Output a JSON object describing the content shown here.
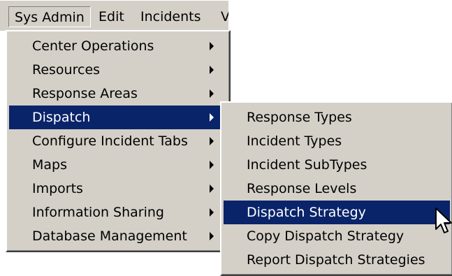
{
  "menubar": {
    "items": [
      {
        "label": "Sys Admin"
      },
      {
        "label": "Edit"
      },
      {
        "label": "Incidents"
      },
      {
        "label": "V"
      }
    ]
  },
  "sys_admin_menu": {
    "items": [
      {
        "label": "Center Operations",
        "has_submenu": true
      },
      {
        "label": "Resources",
        "has_submenu": true
      },
      {
        "label": "Response Areas",
        "has_submenu": true
      },
      {
        "label": "Dispatch",
        "has_submenu": true,
        "selected": true
      },
      {
        "label": "Configure Incident Tabs",
        "has_submenu": true
      },
      {
        "label": "Maps",
        "has_submenu": true
      },
      {
        "label": "Imports",
        "has_submenu": true
      },
      {
        "label": "Information Sharing",
        "has_submenu": true
      },
      {
        "label": "Database Management",
        "has_submenu": true
      }
    ]
  },
  "dispatch_submenu": {
    "items": [
      {
        "label": "Response Types"
      },
      {
        "label": "Incident Types"
      },
      {
        "label": "Incident SubTypes"
      },
      {
        "label": "Response Levels"
      },
      {
        "label": "Dispatch Strategy",
        "selected": true
      },
      {
        "label": "Copy Dispatch Strategy"
      },
      {
        "label": "Report Dispatch Strategies"
      }
    ]
  },
  "colors": {
    "menu_background": "#d4d0c8",
    "selection_background": "#0a246a",
    "selection_text": "#ffffff"
  },
  "icons": {
    "submenu_arrow": "triangle-right-icon",
    "cursor": "mouse-pointer-icon"
  }
}
